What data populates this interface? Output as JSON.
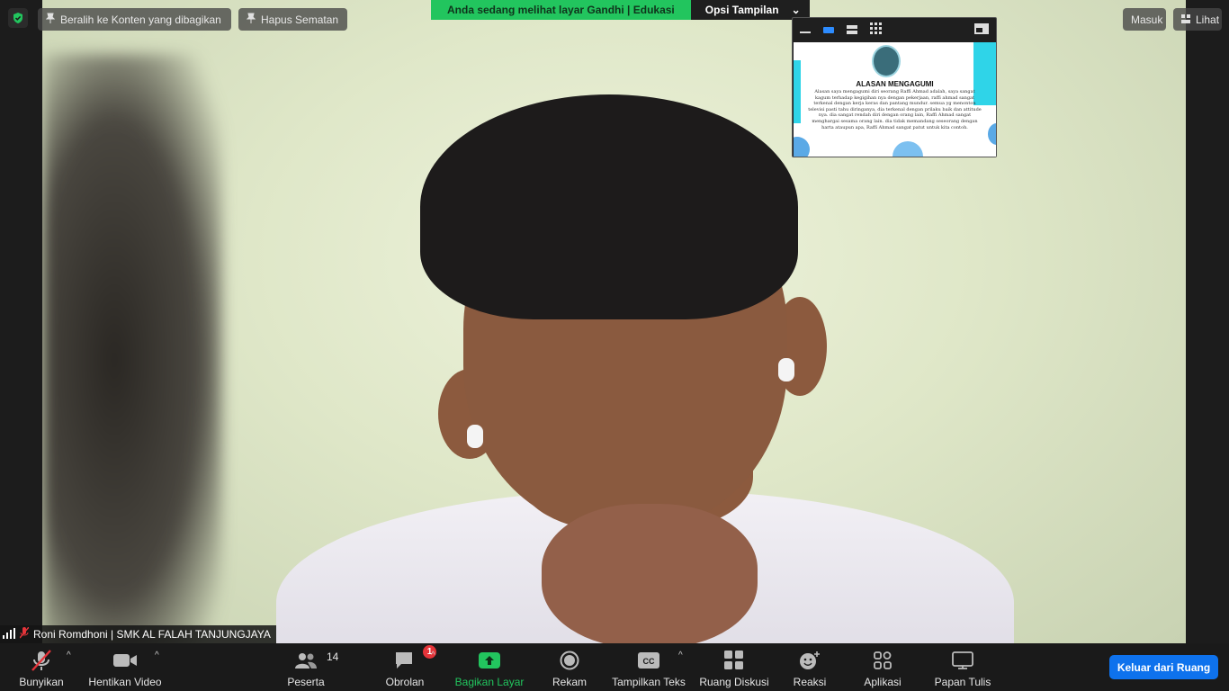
{
  "top": {
    "switch_label": "Beralih ke Konten yang dibagikan",
    "unpin_label": "Hapus Sematan",
    "banner_text": "Anda sedang melihat layar Gandhi | Edukasi",
    "view_options_label": "Opsi Tampilan",
    "enter_label": "Masuk",
    "view_label": "Lihat"
  },
  "shared_doc": {
    "title": "ALASAN MENGAGUMI",
    "body": "Alasan saya mengagumi diri seorang Raffi Ahmad adalah, saya sangat kagum terhadap kegigihan nya dengan pekerjaan, raffi ahmad sangat terkenal dengan kerja keras dan pantang mundur. semua yg menonton televisi pasti tahu diringanya, dia terkenal dengan prilaku baik dan attitude nya. dia sangat rendah diri dengan orang lain, Raffi Ahmad sangat menghargai sesama orang lain. dia tidak memandang seseorang dengan harta ataupun apa, Raffi Ahmad sangat patut untuk kita contoh."
  },
  "participant": {
    "name": "Roni Romdhoni | SMK AL FALAH TANJUNGJAYA"
  },
  "toolbar": {
    "unmute_label": "Bunyikan",
    "stop_video_label": "Hentikan Video",
    "participants_label": "Peserta",
    "participants_count": "14",
    "chat_label": "Obrolan",
    "chat_badge": "1",
    "share_label": "Bagikan Layar",
    "record_label": "Rekam",
    "captions_label": "Tampilkan Teks",
    "breakout_label": "Ruang Diskusi",
    "reactions_label": "Reaksi",
    "apps_label": "Aplikasi",
    "whiteboard_label": "Papan Tulis",
    "leave_label": "Keluar dari Ruang"
  },
  "colors": {
    "banner_green": "#22c55e",
    "share_green": "#22c55e",
    "leave_blue": "#0e72ed",
    "badge_red": "#e5343a"
  }
}
